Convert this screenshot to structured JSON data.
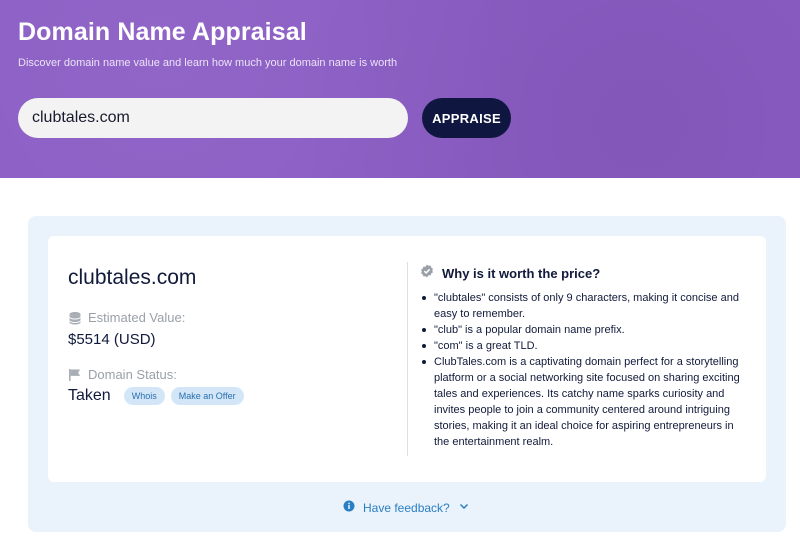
{
  "header": {
    "title": "Domain Name Appraisal",
    "subtitle": "Discover domain name value and learn how much your domain name is worth"
  },
  "search": {
    "value": "clubtales.com",
    "button_label": "APPRAISE"
  },
  "result": {
    "domain": "clubtales.com",
    "estimated_value_label": "Estimated Value:",
    "estimated_value": "$5514 (USD)",
    "status_label": "Domain Status:",
    "status": "Taken",
    "whois_label": "Whois",
    "offer_label": "Make an Offer"
  },
  "why": {
    "heading": "Why is it worth the price?",
    "reasons": [
      "\"clubtales\" consists of only 9 characters, making it concise and easy to remember.",
      "\"club\" is a popular domain name prefix.",
      "\"com\" is a great TLD.",
      "ClubTales.com is a captivating domain perfect for a storytelling platform or a social networking site focused on sharing exciting tales and experiences. Its catchy name sparks curiosity and invites people to join a community centered around intriguing stories, making it an ideal choice for aspiring entrepreneurs in the entertainment realm."
    ]
  },
  "feedback": {
    "label": "Have feedback?"
  },
  "icons": {
    "estimated_value": "coins-icon",
    "status": "flag-icon",
    "why": "verified-badge-icon",
    "feedback": "info-icon",
    "expand": "chevron-down-icon"
  },
  "colors": {
    "hero_bg": "#8a5cc4",
    "button_bg": "#0f1640",
    "panel_bg": "#eaf2fb",
    "pill_bg": "#d3e6f7",
    "link": "#2a7fc4"
  }
}
